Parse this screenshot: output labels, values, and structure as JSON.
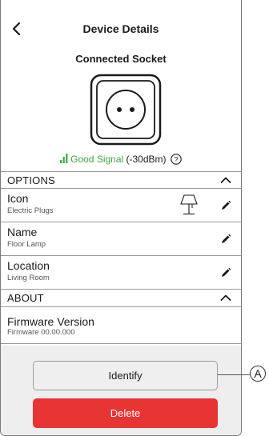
{
  "header": {
    "title": "Device Details",
    "back_icon": "chevron-left-icon"
  },
  "device": {
    "name": "Connected Socket",
    "image_icon": "power-socket-icon",
    "signal_label": "Good Signal",
    "signal_value": "(-30dBm)",
    "signal_icon": "signal-bars-icon",
    "help_icon": "question-circle-icon"
  },
  "options": {
    "header": "OPTIONS",
    "rows": [
      {
        "label": "Icon",
        "value": "Electric Plugs",
        "icon": "floor-lamp-icon"
      },
      {
        "label": "Name",
        "value": "Floor Lamp"
      },
      {
        "label": "Location",
        "value": "Living Room"
      }
    ]
  },
  "about": {
    "header": "ABOUT",
    "firmware_label": "Firmware Version",
    "firmware_value": "Firmware 00.00.000"
  },
  "actions": {
    "identify_label": "Identify",
    "delete_label": "Delete"
  },
  "callout": {
    "label": "A"
  },
  "colors": {
    "good_signal": "#3da63d",
    "delete": "#e83433"
  }
}
